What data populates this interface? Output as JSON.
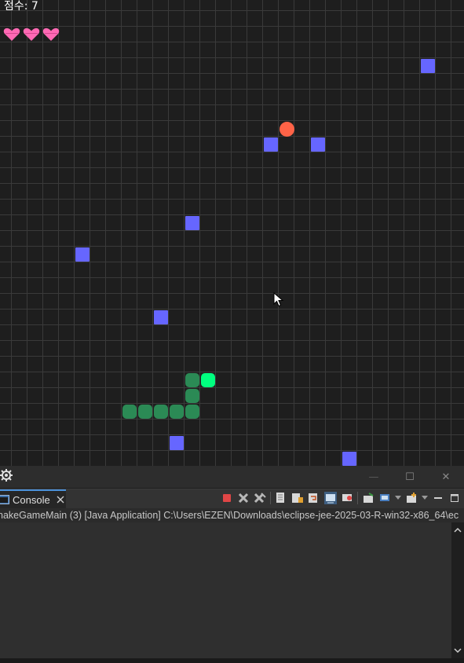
{
  "game": {
    "score_label": "점수: 7",
    "lives": 3,
    "colors": {
      "background": "#1e1e1e",
      "grid": "#3a3a3a",
      "obstacle": "#6666ff",
      "snake_body": "#2b8a55",
      "snake_head": "#00ff7f",
      "food": "#ff6347",
      "heart": "#ff69b4"
    }
  },
  "eclipse": {
    "console_tab_label": "Console",
    "launch_path": "nakeGameMain (3) [Java Application]  C:\\Users\\EZEN\\Downloads\\eclipse-jee-2025-03-R-win32-x86_64\\ec",
    "window_controls": [
      "—",
      "☐",
      "✕"
    ]
  },
  "icons": {
    "heart": "heart-icon",
    "gear": "gear-icon",
    "cursor": "mouse-cursor-icon",
    "console": "console-icon",
    "close": "close-icon",
    "terminate": "terminate-icon",
    "remove_launch": "remove-launch-icon",
    "remove_all": "remove-all-launches-icon",
    "clear_console": "clear-console-icon",
    "scroll_lock": "scroll-lock-icon",
    "word_wrap": "word-wrap-icon",
    "show_on_output": "show-console-on-output-icon",
    "show_on_error": "show-console-on-error-icon",
    "pin_console": "pin-console-icon",
    "display_console": "display-selected-console-icon",
    "open_console": "open-console-icon",
    "minimize": "minimize-icon",
    "maximize": "maximize-icon"
  }
}
